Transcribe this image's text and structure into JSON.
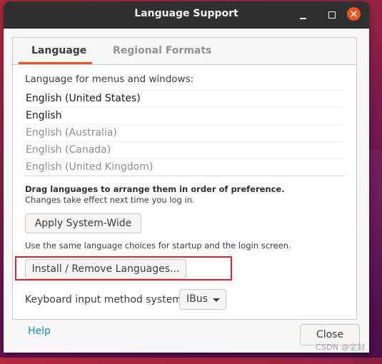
{
  "window": {
    "title": "Language Support",
    "controls": {
      "minimize": "minimize-icon",
      "maximize": "maximize-icon",
      "close": "close-icon"
    }
  },
  "tabs": [
    {
      "label": "Language",
      "active": true
    },
    {
      "label": "Regional Formats",
      "active": false
    }
  ],
  "language_tab": {
    "list_label": "Language for menus and windows:",
    "languages": [
      {
        "label": "English (United States)",
        "enabled": true
      },
      {
        "label": "English",
        "enabled": true
      },
      {
        "label": "English (Australia)",
        "enabled": false
      },
      {
        "label": "English (Canada)",
        "enabled": false
      },
      {
        "label": "English (United Kingdom)",
        "enabled": false
      }
    ],
    "drag_hint": "Drag languages to arrange them in order of preference.",
    "changes_hint": "Changes take effect next time you log in.",
    "apply_button": "Apply System-Wide",
    "apply_hint": "Use the same language choices for startup and the login screen.",
    "install_button": "Install / Remove Languages...",
    "keyboard_label": "Keyboard input method system:",
    "keyboard_value": "IBus"
  },
  "footer": {
    "help_label": "Help",
    "close_label": "Close"
  },
  "colors": {
    "accent": "#e95420",
    "highlight_box": "#e3202c",
    "link": "#1c8bc8"
  },
  "watermark": "CSDN @尘封"
}
